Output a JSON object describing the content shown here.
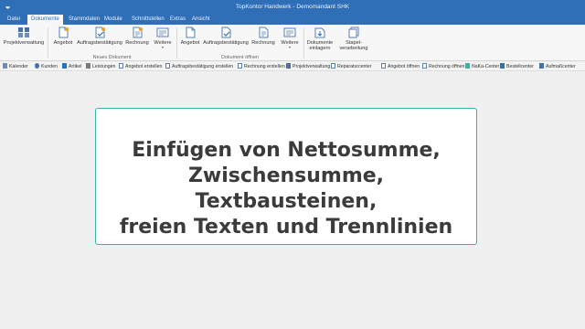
{
  "window": {
    "title": "TopKontor Handwerk - Demomandant SHK",
    "logo": "app-logo-icon"
  },
  "tabs": [
    {
      "label": "Datei",
      "active": false
    },
    {
      "label": "Dokumente",
      "active": true
    },
    {
      "label": "Stammdaten",
      "active": false
    },
    {
      "label": "Module",
      "active": false
    },
    {
      "label": "Schnittstellen",
      "active": false
    },
    {
      "label": "Extras",
      "active": false
    },
    {
      "label": "Ansicht",
      "active": false
    }
  ],
  "ribbon": {
    "projekt": {
      "label": "Projektverwaltung",
      "icon": "grid-icon"
    },
    "neues_dokument": {
      "group_label": "Neues Dokument",
      "buttons": [
        {
          "label": "Angebot",
          "icon": "new-document-icon"
        },
        {
          "label": "Auftragsbestätigung",
          "icon": "new-confirmation-icon"
        },
        {
          "label": "Rechnung",
          "icon": "new-invoice-icon"
        },
        {
          "label": "Weitere",
          "icon": "more-documents-icon"
        }
      ]
    },
    "dokument_oeffnen": {
      "group_label": "Dokument öffnen",
      "buttons": [
        {
          "label": "Angebot",
          "icon": "open-document-icon"
        },
        {
          "label": "Auftragsbestätigung",
          "icon": "open-confirmation-icon"
        },
        {
          "label": "Rechnung",
          "icon": "open-invoice-icon"
        },
        {
          "label": "Weitere",
          "icon": "more-open-icon"
        }
      ]
    },
    "extra": [
      {
        "label_line1": "Dokumente",
        "label_line2": "einlagern",
        "icon": "archive-documents-icon"
      },
      {
        "label_line1": "Stapel-",
        "label_line2": "verarbeitung",
        "icon": "batch-processing-icon"
      }
    ],
    "more_arrow": "▾"
  },
  "quickbar": [
    {
      "label": "Kalender",
      "icon": "calendar-icon"
    },
    {
      "label": "Kunden",
      "icon": "customers-icon"
    },
    {
      "label": "Artikel",
      "icon": "article-icon"
    },
    {
      "label": "Leistungen",
      "icon": "services-icon"
    },
    {
      "label": "Angebot erstellen",
      "icon": "create-offer-icon"
    },
    {
      "label": "Auftragsbestätigung erstellen",
      "icon": "create-confirmation-icon"
    },
    {
      "label": "Rechnung erstellen",
      "icon": "create-invoice-icon"
    },
    {
      "label": "Projektverwaltung",
      "icon": "project-icon"
    },
    {
      "label": "Reparaturcenter",
      "icon": "repair-center-icon"
    },
    {
      "label": "Angebot öffnen",
      "icon": "open-offer-icon"
    },
    {
      "label": "Rechnung öffnen",
      "icon": "open-invoice-small-icon"
    },
    {
      "label": "NaKa-Center",
      "icon": "naka-center-icon"
    },
    {
      "label": "Bestellcenter",
      "icon": "order-center-icon"
    },
    {
      "label": "Aufmaßcenter",
      "icon": "measurement-center-icon"
    }
  ],
  "content": {
    "heading_line1": "Einfügen von Nettosumme,",
    "heading_line2": "Zwischensumme, Textbausteinen,",
    "heading_line3": "freien Texten und Trennlinien"
  },
  "colors": {
    "title_bar": "#2e6fb7",
    "card_border": "#35b3a5",
    "heading": "#3b3b3b"
  }
}
